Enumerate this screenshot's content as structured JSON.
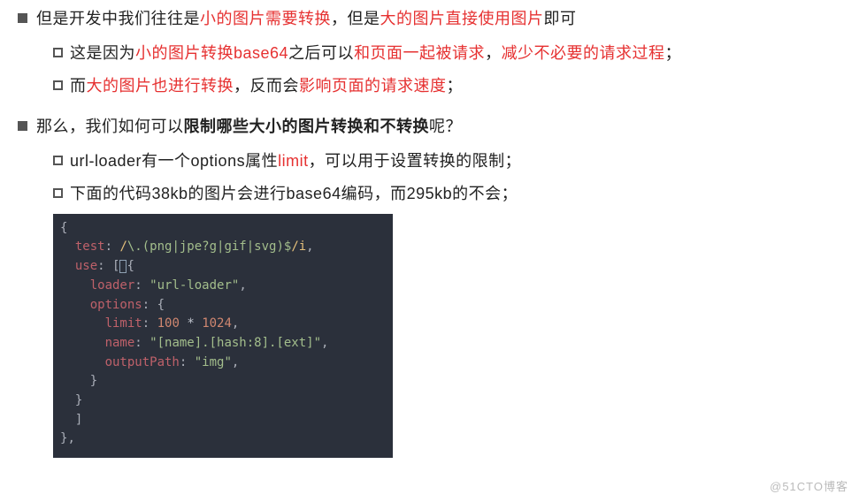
{
  "bullet1": {
    "p1": "但是开发中我们往往是",
    "p2": "小的图片需要转换",
    "p3": "，但是",
    "p4": "大的图片直接使用图片",
    "p5": "即可"
  },
  "bullet1_sub1": {
    "p1": "这是因为",
    "p2": "小的图片转换base64",
    "p3": "之后可以",
    "p4": "和页面一起被请求",
    "p5": "，",
    "p6": "减少不必要的请求过程",
    "p7": "；"
  },
  "bullet1_sub2": {
    "p1": "而",
    "p2": "大的图片也进行转换",
    "p3": "，反而会",
    "p4": "影响页面的请求速度",
    "p5": "；"
  },
  "bullet2": {
    "p1": "那么，我们如何可以",
    "p2": "限制哪些大小的图片转换和不转换",
    "p3": "呢？"
  },
  "bullet2_sub1": {
    "p1": "url-loader有一个options属性",
    "p2": "limit",
    "p3": "，可以用于设置转换的限制；"
  },
  "bullet2_sub2": {
    "p1": "下面的代码38kb的图片会进行base64编码，而295kb的不会；"
  },
  "code": {
    "lbrace": "{",
    "test_key": "test",
    "colon": ": ",
    "regex_open": "/",
    "regex_body": "\\.(png|jpe?g|gif|svg)$",
    "regex_close": "/i",
    "comma": ",",
    "use_key": "use",
    "use_open": "[",
    "loader_key": "loader",
    "loader_val": "\"url-loader\"",
    "options_key": "options",
    "options_open": "{",
    "limit_key": "limit",
    "limit_a": "100",
    "limit_op": " * ",
    "limit_b": "1024",
    "name_key": "name",
    "name_val": "\"[name].[hash:8].[ext]\"",
    "output_key": "outputPath",
    "output_val": "\"img\"",
    "options_close": "}",
    "use_close_inner": "}",
    "use_close": "]",
    "rbrace": "}",
    "trailing_comma": ","
  },
  "watermark": "@51CTO博客"
}
